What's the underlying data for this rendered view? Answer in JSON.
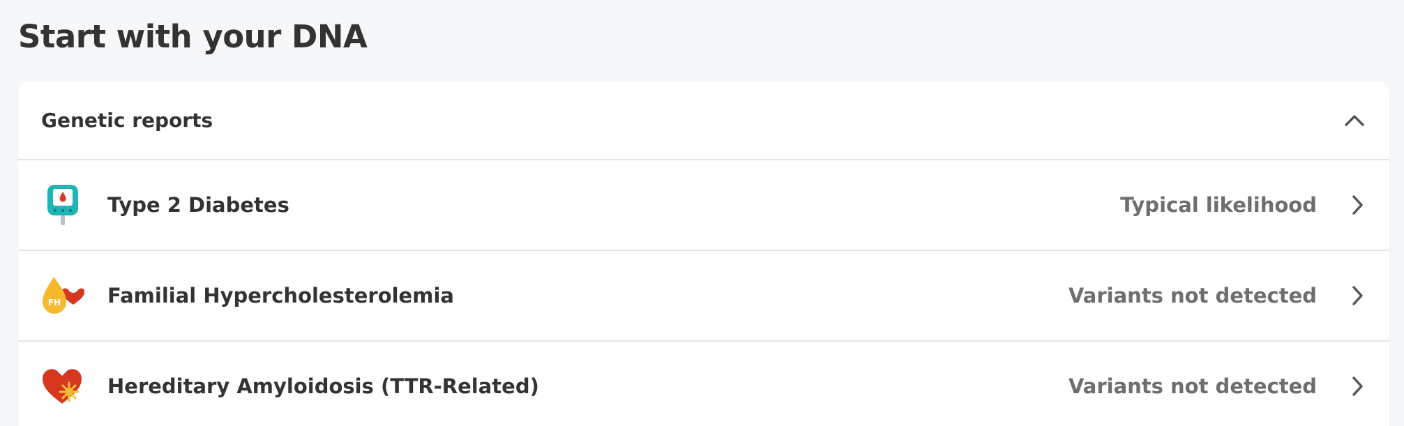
{
  "page": {
    "title": "Start with your DNA"
  },
  "card": {
    "title": "Genetic reports",
    "collapse_icon": "chevron-up-icon",
    "reports": [
      {
        "title": "Type 2 Diabetes",
        "status": "Typical likelihood",
        "icon": "glucose-meter-icon"
      },
      {
        "title": "Familial Hypercholesterolemia",
        "status": "Variants not detected",
        "icon": "fh-droplet-heart-icon",
        "icon_text": "FH"
      },
      {
        "title": "Hereditary Amyloidosis (TTR-Related)",
        "status": "Variants not detected",
        "icon": "heart-burst-icon"
      }
    ]
  },
  "colors": {
    "teal": "#1fb5b5",
    "red": "#d6381f",
    "yellow": "#f5b92e",
    "status_text": "#6e6e6e",
    "chevron": "#555555"
  }
}
